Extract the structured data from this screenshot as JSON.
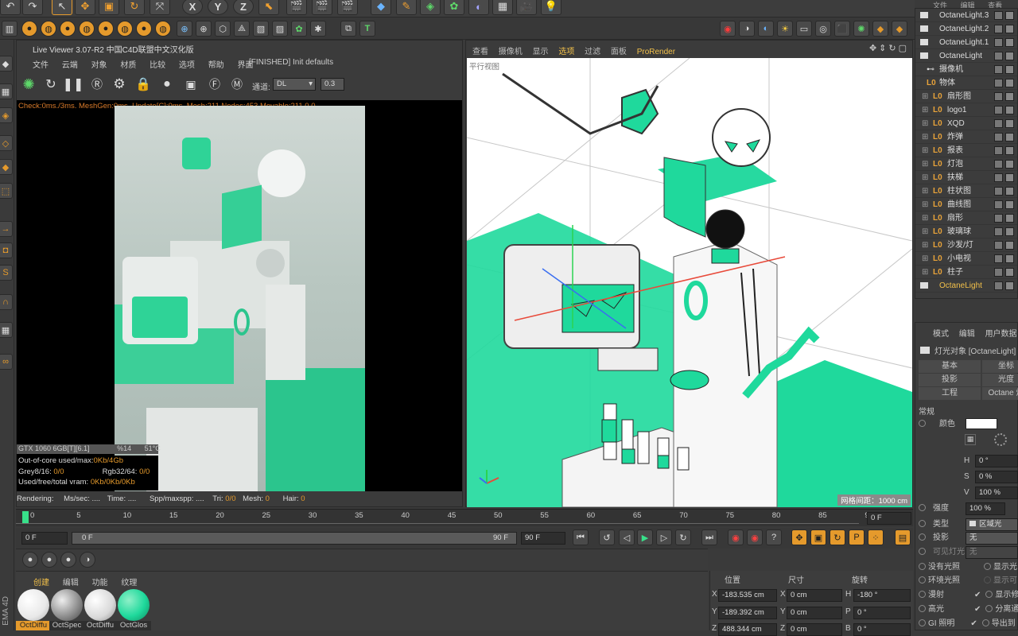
{
  "top_toolbar": {
    "axis_labels": [
      "X",
      "Y",
      "Z"
    ],
    "icons": [
      "undo-icon",
      "pointer-icon",
      "move-icon",
      "scale-icon",
      "rotate-icon",
      "cursor-icon",
      "x-axis-icon",
      "y-axis-icon",
      "z-axis-icon",
      "coord-icon",
      "render-view-icon",
      "render-pic-icon",
      "render-settings-icon",
      "cube-icon",
      "pen-icon",
      "nurbs-icon",
      "array-icon",
      "deformer-icon",
      "floor-icon",
      "camera-icon",
      "light-icon"
    ]
  },
  "top_menu_right": [
    "文件",
    "编辑",
    "查看"
  ],
  "live_viewer": {
    "title": "Live Viewer 3.07-R2 中国C4D联盟中文汉化版",
    "menu": [
      "文件",
      "云端",
      "对象",
      "材质",
      "比较",
      "选项",
      "帮助",
      "界面"
    ],
    "status": "[FINISHED] Init defaults",
    "channel_label": "通道:",
    "channel_value": "DL",
    "channel_num": "0.3",
    "check_line": "Check:0ms./3ms. MeshGen:0ms. Update[C]:0ms. Mesh:211 Nodes:453 Movable:211  0 0",
    "gpu_line": "GTX 1060 6GB[T][6.1]",
    "gpu_pct": "%14",
    "gpu_temp": "51°C",
    "out_of_core": "Out-of-core used/max:",
    "out_of_core_val": "0Kb/4Gb",
    "grey": "Grey8/16:",
    "grey_val": "0/0",
    "rgb": "Rgb32/64:",
    "rgb_val": "0/0",
    "vram": "Used/free/total vram:",
    "vram_val": "0Kb/0Kb/0Kb",
    "rendering_label": "Rendering:",
    "ms_sec": "Ms/sec: ....",
    "time": "Time: ....",
    "spp": "Spp/maxspp: ....",
    "tri_label": "Tri:",
    "tri_val": "0/0",
    "mesh_label": "Mesh:",
    "mesh_val": "0",
    "hair_label": "Hair:",
    "hair_val": "0"
  },
  "viewport": {
    "menu": [
      "查看",
      "摄像机",
      "显示",
      "选项",
      "过滤",
      "面板"
    ],
    "active_menu": "选项",
    "prorender": "ProRender",
    "view_label": "平行视图",
    "grid_label": "网格间距：1000 cm"
  },
  "object_tree": [
    {
      "name": "OctaneLight.3",
      "type": "light"
    },
    {
      "name": "OctaneLight.2",
      "type": "light"
    },
    {
      "name": "OctaneLight.1",
      "type": "light"
    },
    {
      "name": "OctaneLight",
      "type": "light"
    },
    {
      "name": "摄像机",
      "type": "camera"
    },
    {
      "name": "物体",
      "type": "null"
    },
    {
      "name": "扇形图",
      "type": "null"
    },
    {
      "name": "logo1",
      "type": "null"
    },
    {
      "name": "XQD",
      "type": "null"
    },
    {
      "name": "炸弹",
      "type": "null"
    },
    {
      "name": "报表",
      "type": "null"
    },
    {
      "name": "灯泡",
      "type": "null"
    },
    {
      "name": "扶梯",
      "type": "null"
    },
    {
      "name": "柱状图",
      "type": "null"
    },
    {
      "name": "曲线图",
      "type": "null"
    },
    {
      "name": "扇形",
      "type": "null"
    },
    {
      "name": "玻璃球",
      "type": "null"
    },
    {
      "name": "沙发/灯",
      "type": "null"
    },
    {
      "name": "小电视",
      "type": "null"
    },
    {
      "name": "柱子",
      "type": "null"
    },
    {
      "name": "OctaneLight",
      "type": "light-selected"
    }
  ],
  "attributes": {
    "menu": [
      "模式",
      "编辑",
      "用户数据"
    ],
    "object_title": "灯光对象 [OctaneLight]",
    "tabs_row1": [
      "基本",
      "坐标"
    ],
    "tabs_row2": [
      "投影",
      "光度"
    ],
    "tabs_row3": [
      "工程",
      "Octane 灯"
    ],
    "section": "常规",
    "color_label": "颜色",
    "h_label": "H",
    "h_val": "0 °",
    "s_label": "S",
    "s_val": "0 %",
    "v_label": "V",
    "v_val": "100 %",
    "intensity_label": "强度",
    "intensity_val": "100 %",
    "type_label": "类型",
    "type_val": "区域光",
    "shadow_label": "投影",
    "shadow_val": "无",
    "visible_label": "可见灯光",
    "visible_val": "无",
    "no_light_label": "没有光照",
    "show_light_label": "显示光",
    "ambient_label": "环境光照",
    "show_label2": "显示可",
    "diffuse_label": "漫射",
    "show_label3": "显示修",
    "specular_label": "高光",
    "sep_label": "分离通",
    "gi_label": "GI 照明",
    "export_label": "导出到"
  },
  "timeline": {
    "ticks": [
      "0",
      "5",
      "10",
      "15",
      "20",
      "25",
      "30",
      "35",
      "40",
      "45",
      "50",
      "55",
      "60",
      "65",
      "70",
      "75",
      "80",
      "85",
      "90"
    ],
    "current_frame": "0 F",
    "start_frame": "0 F",
    "range_start": "0 F",
    "range_end": "90 F",
    "end_frame": "90 F"
  },
  "material_manager": {
    "menu": [
      "创建",
      "编辑",
      "功能",
      "纹理"
    ],
    "materials": [
      "OctDiffu",
      "OctSpec",
      "OctDiffu",
      "OctGlos"
    ]
  },
  "coords": {
    "headers": [
      "位置",
      "尺寸",
      "旋转"
    ],
    "x": {
      "pos": "-183.535 cm",
      "size": "0 cm",
      "rot": "-180 °"
    },
    "y": {
      "pos": "-189.392 cm",
      "size": "0 cm",
      "rot": "0 °"
    },
    "z": {
      "pos": "488.344 cm",
      "size": "0 cm",
      "rot": "0 °"
    },
    "h_label": "H",
    "p_label": "P",
    "b_label": "B"
  },
  "side_label": "EMA 4D",
  "colors": {
    "accent": "#e59a2c",
    "green": "#2ee0a0",
    "scene_green": "#1fd99c"
  }
}
